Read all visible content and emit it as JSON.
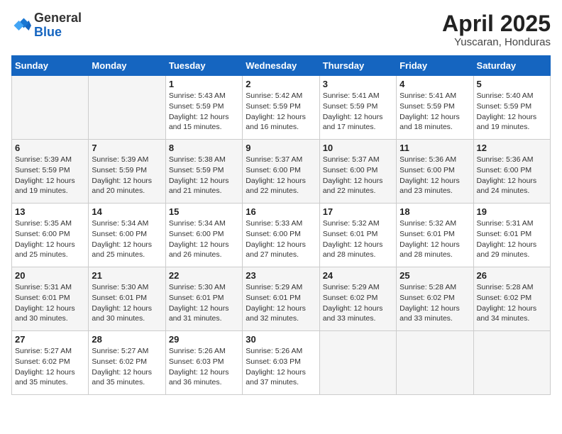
{
  "header": {
    "logo": {
      "general": "General",
      "blue": "Blue"
    },
    "title": "April 2025",
    "subtitle": "Yuscaran, Honduras"
  },
  "days_of_week": [
    "Sunday",
    "Monday",
    "Tuesday",
    "Wednesday",
    "Thursday",
    "Friday",
    "Saturday"
  ],
  "weeks": [
    [
      {
        "day": "",
        "sunrise": "",
        "sunset": "",
        "daylight": ""
      },
      {
        "day": "",
        "sunrise": "",
        "sunset": "",
        "daylight": ""
      },
      {
        "day": "1",
        "sunrise": "Sunrise: 5:43 AM",
        "sunset": "Sunset: 5:59 PM",
        "daylight": "Daylight: 12 hours and 15 minutes."
      },
      {
        "day": "2",
        "sunrise": "Sunrise: 5:42 AM",
        "sunset": "Sunset: 5:59 PM",
        "daylight": "Daylight: 12 hours and 16 minutes."
      },
      {
        "day": "3",
        "sunrise": "Sunrise: 5:41 AM",
        "sunset": "Sunset: 5:59 PM",
        "daylight": "Daylight: 12 hours and 17 minutes."
      },
      {
        "day": "4",
        "sunrise": "Sunrise: 5:41 AM",
        "sunset": "Sunset: 5:59 PM",
        "daylight": "Daylight: 12 hours and 18 minutes."
      },
      {
        "day": "5",
        "sunrise": "Sunrise: 5:40 AM",
        "sunset": "Sunset: 5:59 PM",
        "daylight": "Daylight: 12 hours and 19 minutes."
      }
    ],
    [
      {
        "day": "6",
        "sunrise": "Sunrise: 5:39 AM",
        "sunset": "Sunset: 5:59 PM",
        "daylight": "Daylight: 12 hours and 19 minutes."
      },
      {
        "day": "7",
        "sunrise": "Sunrise: 5:39 AM",
        "sunset": "Sunset: 5:59 PM",
        "daylight": "Daylight: 12 hours and 20 minutes."
      },
      {
        "day": "8",
        "sunrise": "Sunrise: 5:38 AM",
        "sunset": "Sunset: 5:59 PM",
        "daylight": "Daylight: 12 hours and 21 minutes."
      },
      {
        "day": "9",
        "sunrise": "Sunrise: 5:37 AM",
        "sunset": "Sunset: 6:00 PM",
        "daylight": "Daylight: 12 hours and 22 minutes."
      },
      {
        "day": "10",
        "sunrise": "Sunrise: 5:37 AM",
        "sunset": "Sunset: 6:00 PM",
        "daylight": "Daylight: 12 hours and 22 minutes."
      },
      {
        "day": "11",
        "sunrise": "Sunrise: 5:36 AM",
        "sunset": "Sunset: 6:00 PM",
        "daylight": "Daylight: 12 hours and 23 minutes."
      },
      {
        "day": "12",
        "sunrise": "Sunrise: 5:36 AM",
        "sunset": "Sunset: 6:00 PM",
        "daylight": "Daylight: 12 hours and 24 minutes."
      }
    ],
    [
      {
        "day": "13",
        "sunrise": "Sunrise: 5:35 AM",
        "sunset": "Sunset: 6:00 PM",
        "daylight": "Daylight: 12 hours and 25 minutes."
      },
      {
        "day": "14",
        "sunrise": "Sunrise: 5:34 AM",
        "sunset": "Sunset: 6:00 PM",
        "daylight": "Daylight: 12 hours and 25 minutes."
      },
      {
        "day": "15",
        "sunrise": "Sunrise: 5:34 AM",
        "sunset": "Sunset: 6:00 PM",
        "daylight": "Daylight: 12 hours and 26 minutes."
      },
      {
        "day": "16",
        "sunrise": "Sunrise: 5:33 AM",
        "sunset": "Sunset: 6:00 PM",
        "daylight": "Daylight: 12 hours and 27 minutes."
      },
      {
        "day": "17",
        "sunrise": "Sunrise: 5:32 AM",
        "sunset": "Sunset: 6:01 PM",
        "daylight": "Daylight: 12 hours and 28 minutes."
      },
      {
        "day": "18",
        "sunrise": "Sunrise: 5:32 AM",
        "sunset": "Sunset: 6:01 PM",
        "daylight": "Daylight: 12 hours and 28 minutes."
      },
      {
        "day": "19",
        "sunrise": "Sunrise: 5:31 AM",
        "sunset": "Sunset: 6:01 PM",
        "daylight": "Daylight: 12 hours and 29 minutes."
      }
    ],
    [
      {
        "day": "20",
        "sunrise": "Sunrise: 5:31 AM",
        "sunset": "Sunset: 6:01 PM",
        "daylight": "Daylight: 12 hours and 30 minutes."
      },
      {
        "day": "21",
        "sunrise": "Sunrise: 5:30 AM",
        "sunset": "Sunset: 6:01 PM",
        "daylight": "Daylight: 12 hours and 30 minutes."
      },
      {
        "day": "22",
        "sunrise": "Sunrise: 5:30 AM",
        "sunset": "Sunset: 6:01 PM",
        "daylight": "Daylight: 12 hours and 31 minutes."
      },
      {
        "day": "23",
        "sunrise": "Sunrise: 5:29 AM",
        "sunset": "Sunset: 6:01 PM",
        "daylight": "Daylight: 12 hours and 32 minutes."
      },
      {
        "day": "24",
        "sunrise": "Sunrise: 5:29 AM",
        "sunset": "Sunset: 6:02 PM",
        "daylight": "Daylight: 12 hours and 33 minutes."
      },
      {
        "day": "25",
        "sunrise": "Sunrise: 5:28 AM",
        "sunset": "Sunset: 6:02 PM",
        "daylight": "Daylight: 12 hours and 33 minutes."
      },
      {
        "day": "26",
        "sunrise": "Sunrise: 5:28 AM",
        "sunset": "Sunset: 6:02 PM",
        "daylight": "Daylight: 12 hours and 34 minutes."
      }
    ],
    [
      {
        "day": "27",
        "sunrise": "Sunrise: 5:27 AM",
        "sunset": "Sunset: 6:02 PM",
        "daylight": "Daylight: 12 hours and 35 minutes."
      },
      {
        "day": "28",
        "sunrise": "Sunrise: 5:27 AM",
        "sunset": "Sunset: 6:02 PM",
        "daylight": "Daylight: 12 hours and 35 minutes."
      },
      {
        "day": "29",
        "sunrise": "Sunrise: 5:26 AM",
        "sunset": "Sunset: 6:03 PM",
        "daylight": "Daylight: 12 hours and 36 minutes."
      },
      {
        "day": "30",
        "sunrise": "Sunrise: 5:26 AM",
        "sunset": "Sunset: 6:03 PM",
        "daylight": "Daylight: 12 hours and 37 minutes."
      },
      {
        "day": "",
        "sunrise": "",
        "sunset": "",
        "daylight": ""
      },
      {
        "day": "",
        "sunrise": "",
        "sunset": "",
        "daylight": ""
      },
      {
        "day": "",
        "sunrise": "",
        "sunset": "",
        "daylight": ""
      }
    ]
  ]
}
